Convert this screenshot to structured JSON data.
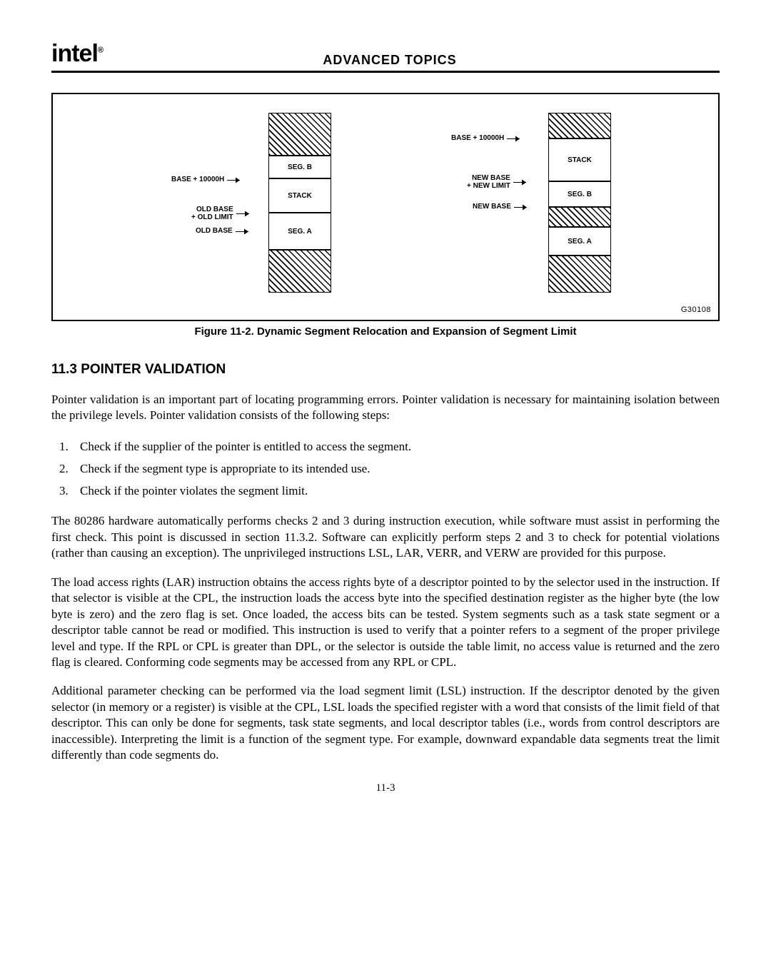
{
  "header": {
    "logo_text": "intel",
    "logo_reg": "®",
    "title": "ADVANCED TOPICS"
  },
  "figure": {
    "caption": "Figure 11-2.  Dynamic Segment Relocation and Expansion of Segment Limit",
    "code": "G30108",
    "left": {
      "lbl_base_10000h": "BASE + 10000H",
      "lbl_old_base_old_limit": "OLD BASE\n+ OLD LIMIT",
      "lbl_old_base": "OLD BASE",
      "seg_b": "SEG. B",
      "stack": "STACK",
      "seg_a": "SEG. A"
    },
    "right": {
      "lbl_base_10000h": "BASE + 10000H",
      "lbl_new_base_new_limit": "NEW BASE\n+ NEW LIMIT",
      "lbl_new_base": "NEW BASE",
      "stack": "STACK",
      "seg_b": "SEG. B",
      "seg_a": "SEG. A"
    }
  },
  "section": {
    "heading": "11.3  POINTER VALIDATION",
    "para1": "Pointer validation is an important part of locating programming errors. Pointer validation is necessary for maintaining isolation between the privilege levels. Pointer validation consists of the following steps:",
    "steps": [
      "Check if the supplier of the pointer is entitled to access the segment.",
      "Check if the segment type is appropriate to its intended use.",
      "Check if the pointer violates the segment limit."
    ],
    "para2": "The 80286 hardware automatically performs checks 2 and 3 during instruction execution, while software must assist in performing the first check. This point is discussed in section 11.3.2. Software can explicitly perform steps 2 and 3 to check for potential violations (rather than causing an exception). The unprivileged instructions LSL, LAR, VERR, and VERW are provided for this purpose.",
    "para3": "The load access rights (LAR) instruction obtains the access rights byte of a descriptor pointed to by the selector used in the instruction. If that selector is visible at the CPL, the instruction loads the access byte into the specified destination register as the higher byte (the low byte is zero) and the zero flag is set. Once loaded, the access bits can be tested. System segments such as a task state segment or a descriptor table cannot be read or modified. This instruction is used to verify that a pointer refers to a segment of the proper privilege level and type. If the RPL or CPL is greater than DPL, or the selector is outside the table limit, no access value is returned and the zero flag is cleared. Conforming code segments may be accessed from any RPL or CPL.",
    "para4": "Additional parameter checking can be performed via the load segment limit (LSL) instruction. If the descriptor denoted by the given selector (in memory or a register) is visible at the CPL, LSL loads the specified register with a word that consists of the limit field of that descriptor. This can only be done for segments, task state segments, and local descriptor tables (i.e., words from control descriptors are inaccessible). Interpreting the limit is a function of the segment type. For example, downward expandable data segments treat the limit differently than code segments do."
  },
  "page_number": "11-3"
}
